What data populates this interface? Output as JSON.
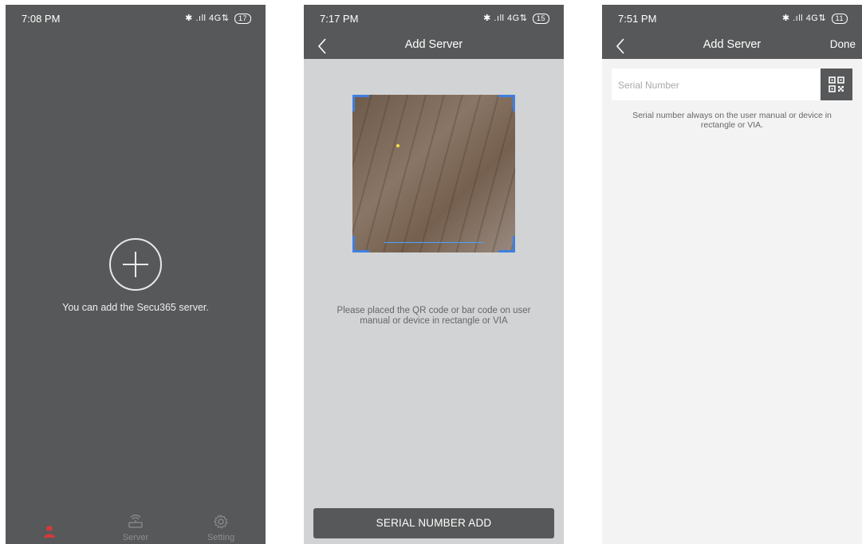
{
  "screens": {
    "home": {
      "status": {
        "time": "7:08 PM",
        "network": "4G",
        "battery": "17"
      },
      "empty_message": "You can add the Secu365 server.",
      "tabs": [
        {
          "label": "",
          "icon": "user-icon",
          "color": "#d23a3a"
        },
        {
          "label": "Server",
          "icon": "router-icon"
        },
        {
          "label": "Setting",
          "icon": "gear-icon"
        }
      ]
    },
    "scan": {
      "status": {
        "time": "7:17 PM",
        "network": "4G",
        "battery": "15"
      },
      "title": "Add Server",
      "hint": "Please placed the QR code or bar code on user manual or device in rectangle or VIA",
      "serial_button": "SERIAL NUMBER ADD"
    },
    "manual": {
      "status": {
        "time": "7:51 PM",
        "network": "4G",
        "battery": "11"
      },
      "title": "Add Server",
      "done": "Done",
      "serial_placeholder": "Serial Number",
      "serial_value": "",
      "hint": "Serial number always on the user manual or device in rectangle or VIA."
    }
  },
  "colors": {
    "header": "#575859",
    "accent_red": "#d23a3a",
    "scan_corner": "#3f7fe0"
  }
}
